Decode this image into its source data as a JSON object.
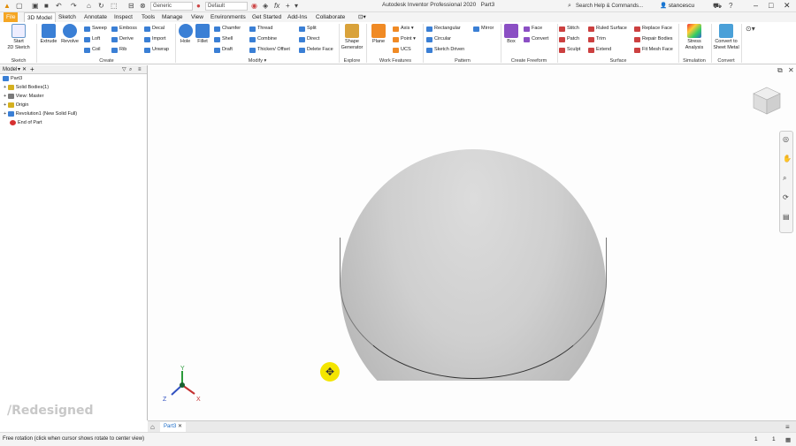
{
  "title_bar": {
    "app_title": "Autodesk Inventor Professional 2020",
    "doc_name": "Part3",
    "material": "Generic",
    "appearance": "Default",
    "search_placeholder": "Search Help & Commands...",
    "user": "stancescu"
  },
  "tabs": [
    "File",
    "3D Model",
    "Sketch",
    "Annotate",
    "Inspect",
    "Tools",
    "Manage",
    "View",
    "Environments",
    "Get Started",
    "Add-Ins",
    "Collaborate"
  ],
  "active_tab": "3D Model",
  "ribbon": {
    "sketch": {
      "start": "Start",
      "sub": "2D Sketch",
      "group": "Sketch"
    },
    "create": {
      "extrude": "Extrude",
      "revolve": "Revolve",
      "sweep": "Sweep",
      "loft": "Loft",
      "coil": "Coil",
      "emboss": "Emboss",
      "derive": "Derive",
      "rib": "Rib",
      "decal": "Decal",
      "import": "Import",
      "unwrap": "Unwrap",
      "group": "Create"
    },
    "modify": {
      "hole": "Hole",
      "fillet": "Fillet",
      "chamfer": "Chamfer",
      "shell": "Shell",
      "draft": "Draft",
      "thread": "Thread",
      "combine": "Combine",
      "thicken": "Thicken/ Offset",
      "split": "Split",
      "direct": "Direct",
      "delete_face": "Delete Face",
      "group": "Modify"
    },
    "explore": {
      "shape_generator": "Shape Generator",
      "group": "Explore"
    },
    "work_features": {
      "plane": "Plane",
      "axis": "Axis",
      "point": "Point",
      "ucs": "UCS",
      "group": "Work Features"
    },
    "pattern": {
      "rectangular": "Rectangular",
      "circular": "Circular",
      "sketch_driven": "Sketch Driven",
      "mirror": "Mirror",
      "group": "Pattern"
    },
    "freeform": {
      "box": "Box",
      "face": "Face",
      "convert": "Convert",
      "group": "Create Freeform"
    },
    "surface": {
      "stitch": "Stitch",
      "patch": "Patch",
      "sculpt": "Sculpt",
      "ruled_surface": "Ruled Surface",
      "trim": "Trim",
      "extend": "Extend",
      "replace_face": "Replace Face",
      "repair_bodies": "Repair Bodies",
      "fit_mesh_face": "Fit Mesh Face",
      "group": "Surface"
    },
    "simulation": {
      "stress": "Stress Analysis",
      "group": "Simulation"
    },
    "convert": {
      "sheet_metal": "Convert to Sheet Metal",
      "group": "Convert"
    }
  },
  "browser": {
    "tab": "Model",
    "items": [
      "Part3",
      "Solid Bodies(1)",
      "View: Master",
      "Origin",
      "Revolution1 (New Solid Full)",
      "End of Part"
    ]
  },
  "document_tab": "Part3",
  "watermark": "/Redesigned",
  "status": {
    "text": "Free rotation (click when cursor shows rotate to center view)",
    "n1": "1",
    "n2": "1"
  },
  "axes": {
    "x": "X",
    "y": "Y",
    "z": "Z"
  }
}
